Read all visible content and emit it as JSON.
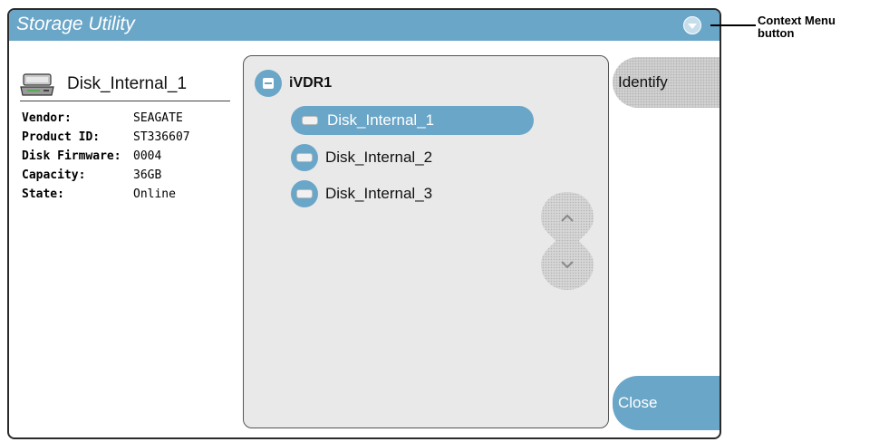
{
  "window": {
    "title": "Storage Utility",
    "context_menu_icon": "chevron-down-icon"
  },
  "disk_info": {
    "icon": "hard-disk-icon",
    "name": "Disk_Internal_1",
    "properties": [
      {
        "label": "Vendor:",
        "value": "SEAGATE"
      },
      {
        "label": "Product ID:",
        "value": "ST336607"
      },
      {
        "label": "Disk Firmware:",
        "value": "0004"
      },
      {
        "label": "Capacity:",
        "value": "36GB"
      },
      {
        "label": "State:",
        "value": "Online"
      }
    ]
  },
  "tree": {
    "root": {
      "label": "iVDR1",
      "icon": "collapse-minus-icon"
    },
    "children": [
      {
        "label": "Disk_Internal_1",
        "icon": "disk-icon",
        "selected": true
      },
      {
        "label": "Disk_Internal_2",
        "icon": "disk-icon",
        "selected": false
      },
      {
        "label": "Disk_Internal_3",
        "icon": "disk-icon",
        "selected": false
      }
    ],
    "scroll_icons": [
      "chevron-up-icon",
      "chevron-down-icon"
    ]
  },
  "buttons": {
    "identify": "Identify",
    "close": "Close"
  },
  "annotation": {
    "line1": "Context Menu",
    "line2": "button"
  },
  "colors": {
    "accent": "#6aa6c8",
    "panel": "#e9e9e9"
  }
}
